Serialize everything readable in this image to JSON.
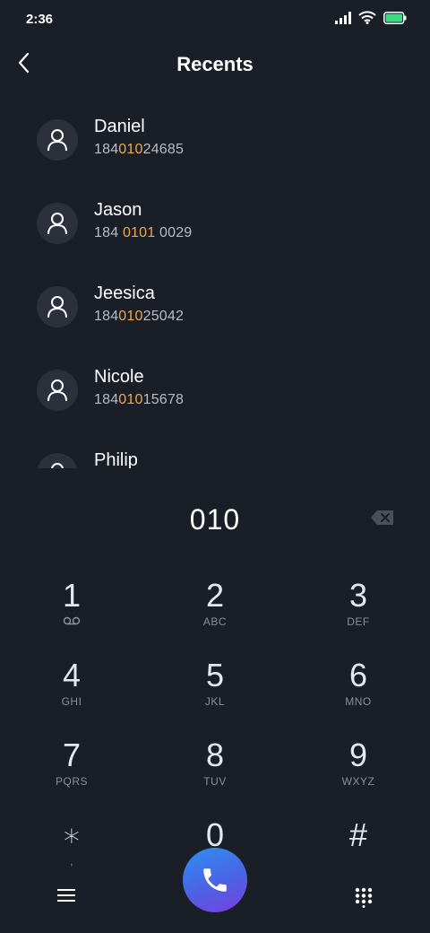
{
  "status_bar": {
    "time": "2:36",
    "icons": [
      "signal-icon",
      "wifi-icon",
      "battery-icon"
    ],
    "battery_color": "#3ddc84"
  },
  "header": {
    "title": "Recents",
    "back_icon": "chevron-left-icon"
  },
  "recents": [
    {
      "name": "Daniel",
      "number_pre": "184",
      "number_match": "010",
      "number_post": "24685"
    },
    {
      "name": "Jason",
      "number_pre": "184 ",
      "number_match": "0101",
      "number_post": " 0029"
    },
    {
      "name": "Jeesica",
      "number_pre": "184",
      "number_match": "010",
      "number_post": "25042"
    },
    {
      "name": "Nicole",
      "number_pre": "184",
      "number_match": "010",
      "number_post": "15678"
    },
    {
      "name": "Philip",
      "number_pre": "",
      "number_match": "",
      "number_post": ""
    }
  ],
  "dialer": {
    "value": "010",
    "backspace_icon": "backspace-icon"
  },
  "keys": [
    {
      "digit": "1",
      "letters": ""
    },
    {
      "digit": "2",
      "letters": "ABC"
    },
    {
      "digit": "3",
      "letters": "DEF"
    },
    {
      "digit": "4",
      "letters": "GHI"
    },
    {
      "digit": "5",
      "letters": "JKL"
    },
    {
      "digit": "6",
      "letters": "MNO"
    },
    {
      "digit": "7",
      "letters": "PQRS"
    },
    {
      "digit": "8",
      "letters": "TUV"
    },
    {
      "digit": "9",
      "letters": "WXYZ"
    },
    {
      "digit": "∗",
      "letters": ","
    },
    {
      "digit": "0",
      "letters": ""
    },
    {
      "digit": "#",
      "letters": ""
    }
  ],
  "bottom_bar": {
    "menu_icon": "menu-icon",
    "call_icon": "phone-icon",
    "keypad_icon": "keypad-icon"
  },
  "colors": {
    "background": "#1a1e27",
    "highlight": "#f0a84a",
    "avatar_bg": "#2b303b"
  }
}
